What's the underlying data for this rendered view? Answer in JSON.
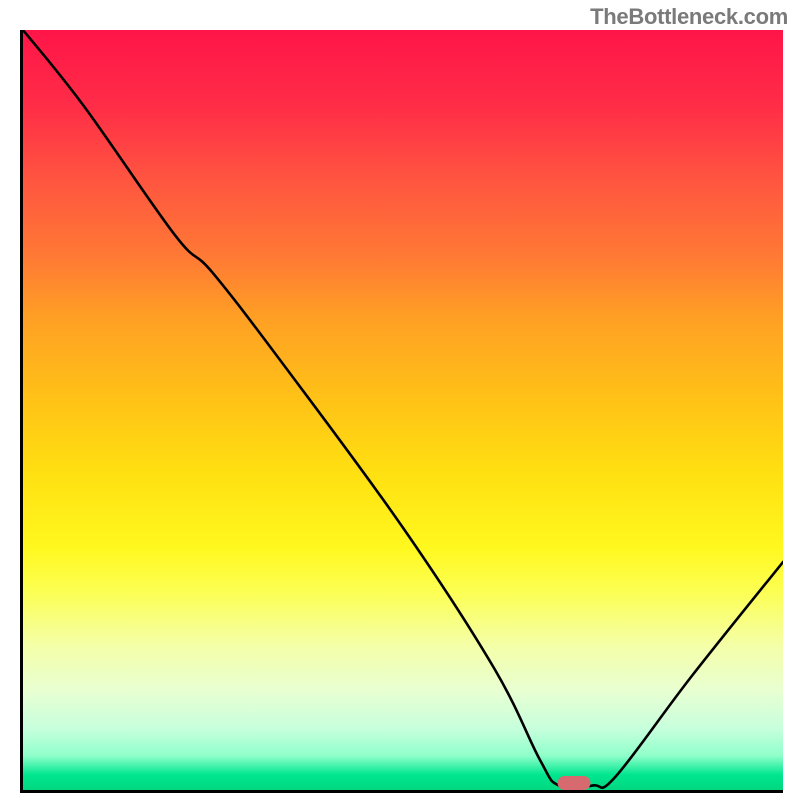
{
  "watermark": "TheBottleneck.com",
  "chart_data": {
    "type": "line",
    "title": "",
    "xlabel": "",
    "ylabel": "",
    "xlim": [
      0,
      100
    ],
    "ylim": [
      0,
      100
    ],
    "series": [
      {
        "name": "curve",
        "x": [
          0,
          8,
          20,
          25,
          35,
          50,
          62,
          68,
          70.5,
          75,
          78,
          88,
          100
        ],
        "values": [
          100,
          90,
          73,
          68,
          55,
          34.5,
          16,
          4,
          0.6,
          0.6,
          1.8,
          15,
          30
        ]
      }
    ],
    "marker": {
      "x": 72.5,
      "y": 0.9
    },
    "colors": {
      "curve_stroke": "#000000",
      "marker_fill": "#d76a6f",
      "axis": "#000000"
    }
  }
}
